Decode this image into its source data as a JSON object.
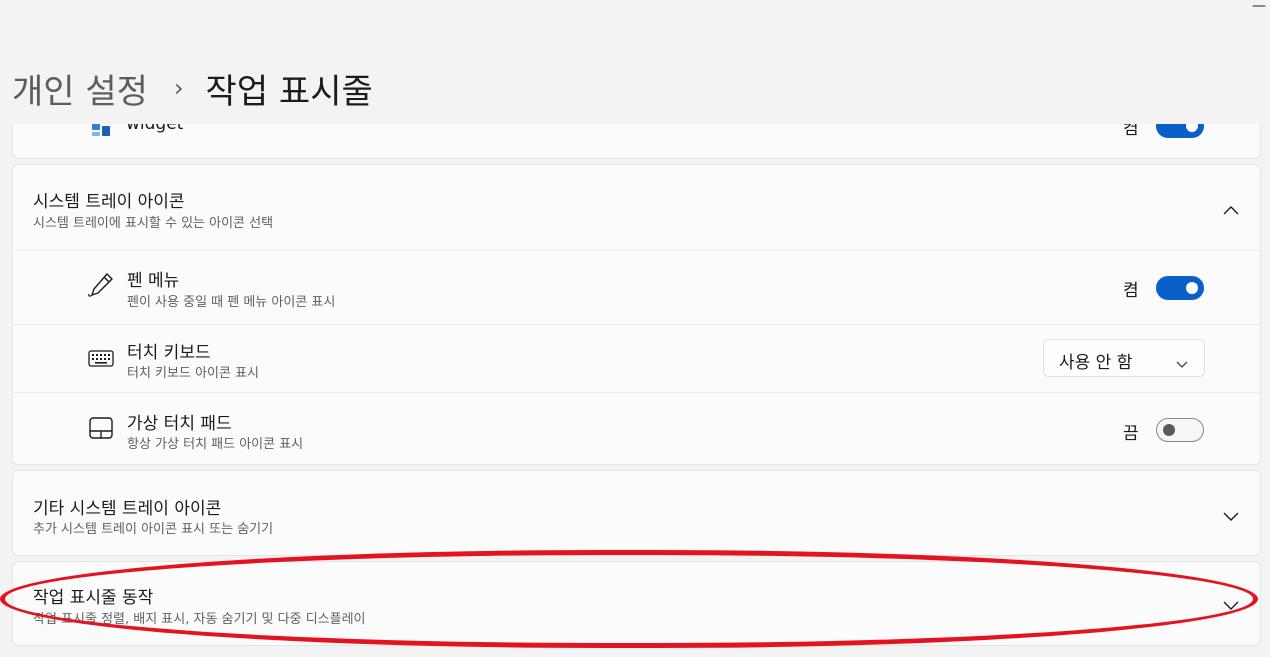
{
  "window": {
    "minimize_glyph": "—"
  },
  "header": {
    "breadcrumb_parent": "개인 설정",
    "breadcrumb_separator": "›",
    "breadcrumb_current": "작업 표시줄"
  },
  "widget_row": {
    "title": "widget",
    "toggle_label": "켬",
    "toggle_state": "on"
  },
  "system_tray": {
    "title": "시스템 트레이 아이콘",
    "subtitle": "시스템 트레이에 표시할 수 있는 아이콘 선택",
    "expanded": true,
    "items": [
      {
        "title": "펜 메뉴",
        "subtitle": "펜이 사용 중일 때 펜 메뉴 아이콘 표시",
        "icon": "pen-icon",
        "control": "toggle",
        "toggle_label": "켬",
        "toggle_state": "on"
      },
      {
        "title": "터치 키보드",
        "subtitle": "터치 키보드 아이콘 표시",
        "icon": "keyboard-icon",
        "control": "dropdown",
        "dropdown_value": "사용 안 함"
      },
      {
        "title": "가상 터치 패드",
        "subtitle": "항상 가상 터치 패드 아이콘 표시",
        "icon": "touchpad-icon",
        "control": "toggle",
        "toggle_label": "끔",
        "toggle_state": "off"
      }
    ]
  },
  "other_tray": {
    "title": "기타 시스템 트레이 아이콘",
    "subtitle": "추가 시스템 트레이 아이콘 표시 또는 숨기기",
    "expanded": false
  },
  "taskbar_behavior": {
    "title": "작업 표시줄 동작",
    "subtitle": "작업 표시줄 정렬, 배지 표시, 자동 숨기기 및 다중 디스플레이",
    "expanded": false,
    "highlight_color": "#e3141f"
  },
  "colors": {
    "accent": "#0a5fc9",
    "background": "#f3f3f3",
    "card": "#fbfbfb"
  }
}
